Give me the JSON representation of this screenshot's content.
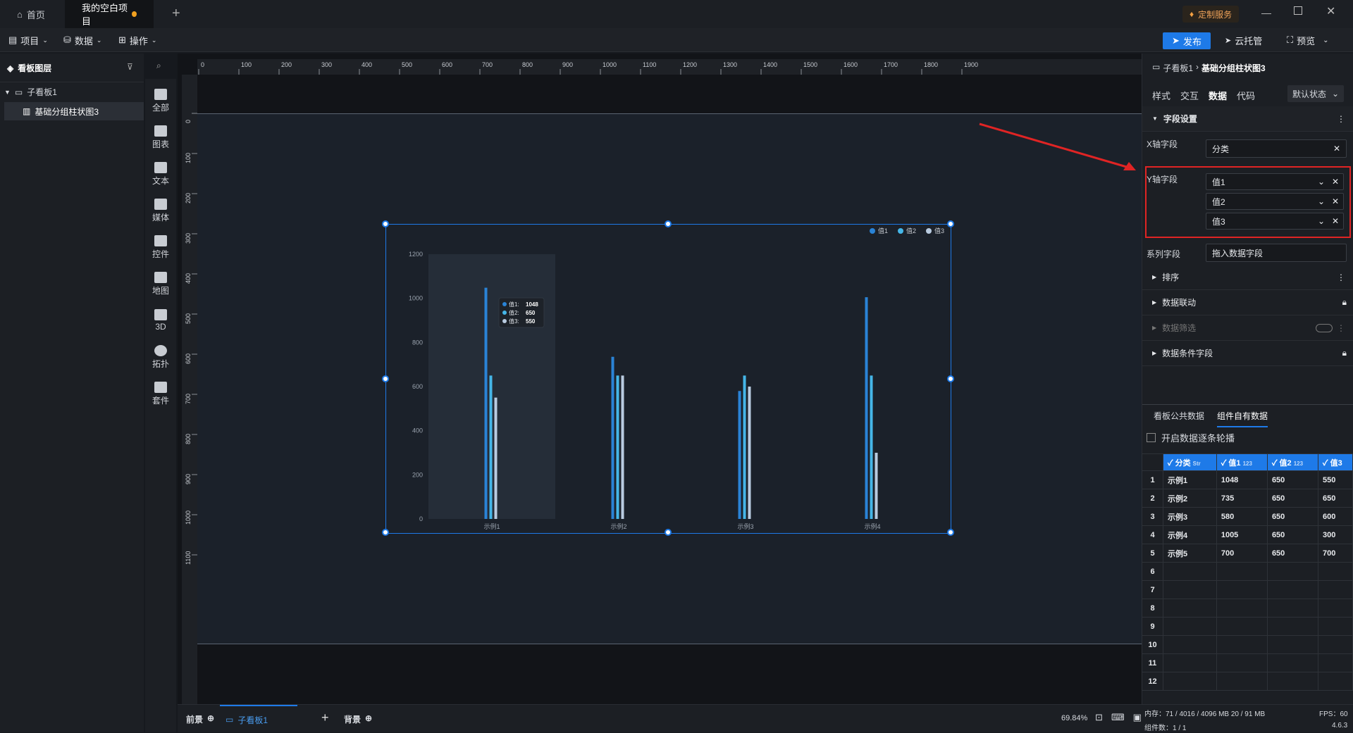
{
  "tabs": [
    {
      "label": "首页"
    },
    {
      "label": "我的空白项目"
    }
  ],
  "topright": {
    "custom_service": "定制服务"
  },
  "menus": {
    "project": "项目",
    "data": "数据",
    "ops": "操作"
  },
  "actions": {
    "publish": "发布",
    "cloud": "云托管",
    "preview": "预览"
  },
  "layers": {
    "title": "看板图层",
    "board": "子看板1",
    "item": "基础分组柱状图3"
  },
  "iconbar": [
    {
      "label": "全部"
    },
    {
      "label": "图表"
    },
    {
      "label": "文本"
    },
    {
      "label": "媒体"
    },
    {
      "label": "控件"
    },
    {
      "label": "地图"
    },
    {
      "label": "3D"
    },
    {
      "label": "拓扑"
    },
    {
      "label": "套件"
    }
  ],
  "ruler": {
    "top": [
      "0",
      "100",
      "200",
      "300",
      "400",
      "500",
      "600",
      "700",
      "800",
      "900",
      "1000",
      "1100",
      "1200",
      "1300",
      "1400",
      "1500",
      "1600",
      "1700",
      "1800",
      "1900"
    ],
    "left": [
      "0",
      "100",
      "200",
      "300",
      "400",
      "500",
      "600",
      "700",
      "800",
      "900",
      "1000",
      "1100"
    ]
  },
  "chart_data": {
    "type": "bar",
    "categories": [
      "示例1",
      "示例2",
      "示例3",
      "示例4"
    ],
    "series": [
      {
        "name": "值1",
        "values": [
          1048,
          735,
          580,
          1005
        ],
        "color": "#2a83d6"
      },
      {
        "name": "值2",
        "values": [
          650,
          650,
          650,
          650
        ],
        "color": "#45b6e8"
      },
      {
        "name": "值3",
        "values": [
          550,
          650,
          600,
          300
        ],
        "color": "#b9cbe0"
      }
    ],
    "yticks": [
      "0",
      "200",
      "400",
      "600",
      "800",
      "1000",
      "1200"
    ],
    "ylim": [
      0,
      1200
    ],
    "legend_position": "top-right",
    "tooltip": {
      "rows": [
        {
          "label": "值1:",
          "value": "1048"
        },
        {
          "label": "值2:",
          "value": "650"
        },
        {
          "label": "值3:",
          "value": "550"
        }
      ]
    }
  },
  "right": {
    "breadcrumb_parent": "子看板1",
    "breadcrumb_current": "基础分组柱状图3",
    "tabs": [
      "样式",
      "交互",
      "数据",
      "代码"
    ],
    "state": "默认状态",
    "field_settings": "字段设置",
    "x_label": "X轴字段",
    "x_value": "分类",
    "y_label": "Y轴字段",
    "y_values": [
      "值1",
      "值2",
      "值3"
    ],
    "series_label": "系列字段",
    "series_placeholder": "拖入数据字段",
    "sections": [
      "排序",
      "数据联动",
      "数据筛选",
      "数据条件字段"
    ],
    "data_tabs": [
      "看板公共数据",
      "组件自有数据"
    ],
    "carousel_label": "开启数据逐条轮播",
    "table_headers": [
      {
        "name": "分类",
        "type": "Str"
      },
      {
        "name": "值1",
        "type": "123"
      },
      {
        "name": "值2",
        "type": "123"
      },
      {
        "name": "值3",
        "type": "123"
      }
    ],
    "rows": [
      [
        "1",
        "示例1",
        "1048",
        "650",
        "550"
      ],
      [
        "2",
        "示例2",
        "735",
        "650",
        "650"
      ],
      [
        "3",
        "示例3",
        "580",
        "650",
        "600"
      ],
      [
        "4",
        "示例4",
        "1005",
        "650",
        "300"
      ],
      [
        "5",
        "示例5",
        "700",
        "650",
        "700"
      ],
      [
        "6",
        "",
        "",
        "",
        ""
      ],
      [
        "7",
        "",
        "",
        "",
        ""
      ],
      [
        "8",
        "",
        "",
        "",
        ""
      ],
      [
        "9",
        "",
        "",
        "",
        ""
      ],
      [
        "10",
        "",
        "",
        "",
        ""
      ],
      [
        "11",
        "",
        "",
        "",
        ""
      ],
      [
        "12",
        "",
        "",
        "",
        ""
      ]
    ]
  },
  "bottom": {
    "front": "前景",
    "board_tab": "子看板1",
    "back": "背景",
    "zoom": "69.84%",
    "memory": "内存：71 / 4016 / 4096 MB  20 / 91 MB",
    "fps": "FPS：60",
    "components": "组件数：1 / 1",
    "version": "4.6.3"
  }
}
